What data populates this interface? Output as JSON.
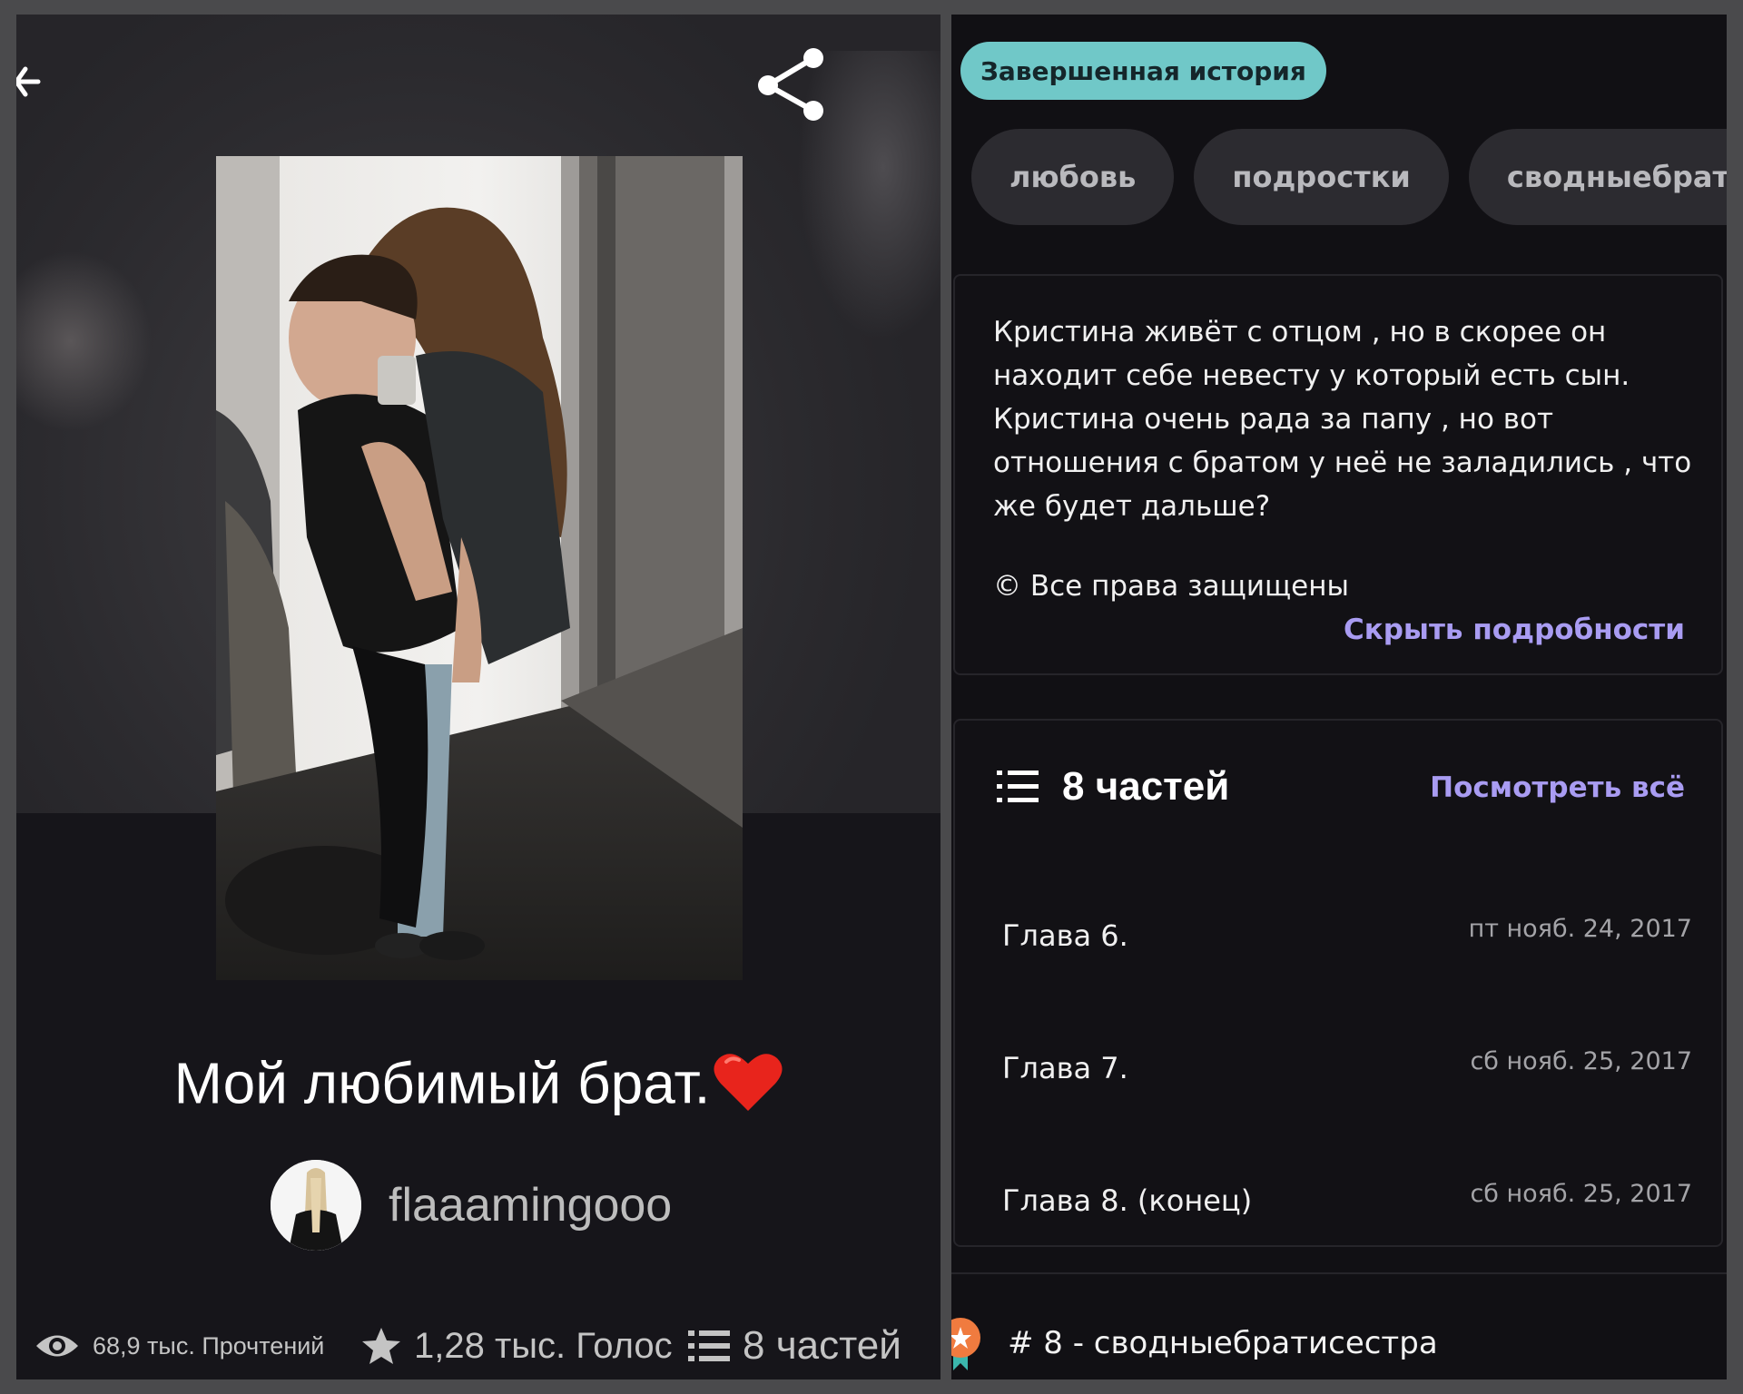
{
  "left": {
    "title": "Мой любимый брат.",
    "title_emoji": "heart",
    "author": "flaaamingooo",
    "stats": {
      "reads": "68,9 тыс. Прочтений",
      "votes": "1,28 тыс. Голос",
      "parts": "8 частей"
    }
  },
  "right": {
    "status": "Завершенная история",
    "tags": [
      "любовь",
      "подростки",
      "сводныебратисе"
    ],
    "description": "Кристина живёт с отцом , но в скорее он находит себе невесту у который есть сын. Кристина очень рада за папу , но вот отношения с братом у неё не заладились , что же будет дальше?",
    "copyright": "© Все права защищены",
    "hide_details": "Скрыть подробности",
    "parts": {
      "title": "8 частей",
      "view_all": "Посмотреть всё",
      "chapters": [
        {
          "name": "Глава 6.",
          "date": "пт нояб. 24, 2017"
        },
        {
          "name": "Глава 7.",
          "date": "сб нояб. 25, 2017"
        },
        {
          "name": "Глава 8. (конец)",
          "date": "сб нояб. 25, 2017"
        }
      ]
    },
    "ranking": "# 8 - сводныебратисестра"
  },
  "colors": {
    "badge": "#70c8c8",
    "link": "#a99cf2",
    "tag_bg": "#2c2b30",
    "panel_bg": "#111014"
  },
  "icons": [
    "back-arrow-icon",
    "share-icon",
    "eye-icon",
    "star-icon",
    "list-icon",
    "heart-icon",
    "ranking-badge-icon"
  ]
}
